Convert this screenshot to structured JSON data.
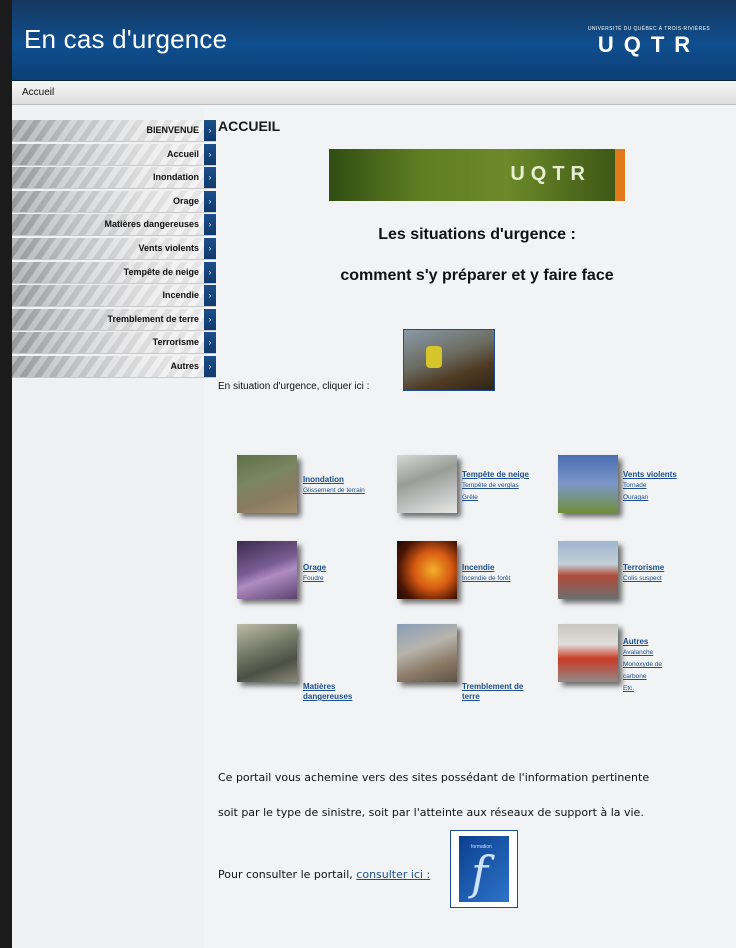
{
  "header": {
    "title": "En cas d'urgence",
    "logo_small": "UNIVERSITÉ DU QUÉBEC À TROIS-RIVIÈRES",
    "logo_big": "UQTR"
  },
  "breadcrumb": "Accueil",
  "sidebar": {
    "items": [
      {
        "label": "BIENVENUE"
      },
      {
        "label": "Accueil"
      },
      {
        "label": "Inondation"
      },
      {
        "label": "Orage"
      },
      {
        "label": "Matières dangereuses"
      },
      {
        "label": "Vents violents"
      },
      {
        "label": "Tempête de neige"
      },
      {
        "label": "Incendie"
      },
      {
        "label": "Tremblement de terre"
      },
      {
        "label": "Terrorisme"
      },
      {
        "label": "Autres"
      }
    ],
    "arrow_glyph": "›"
  },
  "main": {
    "heading": "ACCUEIL",
    "banner_text": "UQTR",
    "title1": "Les situations d'urgence :",
    "title2": "comment s'y préparer et y faire face",
    "emergency_text": "En situation d'urgence, cliquer ici :",
    "categories": [
      {
        "title": "Inondation",
        "links": [
          "Glissement de terrain"
        ]
      },
      {
        "title": "Tempête de neige",
        "links": [
          "Tempête de verglas",
          "Grêle"
        ]
      },
      {
        "title": "Vents violents",
        "links": [
          "Tornade",
          "Ouragan"
        ]
      },
      {
        "title": "Orage",
        "links": [
          "Foudre"
        ]
      },
      {
        "title": "Incendie",
        "links": [
          "Incendie de forêt"
        ]
      },
      {
        "title": "Terrorisme",
        "links": [
          "Colis suspect"
        ]
      },
      {
        "title": "Matières dangereuses",
        "links": []
      },
      {
        "title": "Tremblement de terre",
        "links": []
      },
      {
        "title": "Autres",
        "links": [
          "Avalanche",
          "Monoxyde de carbone",
          "Etc."
        ]
      }
    ],
    "portal_text1": "Ce portail vous achemine vers des sites possédant de l'information pertinente",
    "portal_text2": "soit par le type de sinistre, soit par l'atteinte aux réseaux de support à la vie.",
    "portal_text3_prefix": "Pour consulter le portail,",
    "portal_link": "consulter ici :",
    "portal_img_label": "formation",
    "portal_img_letter": "f"
  },
  "colors": {
    "header_blue": "#0f4e8e",
    "link_blue": "#1c4f8b",
    "banner_green": "#5e7d22",
    "banner_orange": "#e0791a"
  },
  "icons": {
    "nav_arrow": "chevron-right-icon"
  }
}
